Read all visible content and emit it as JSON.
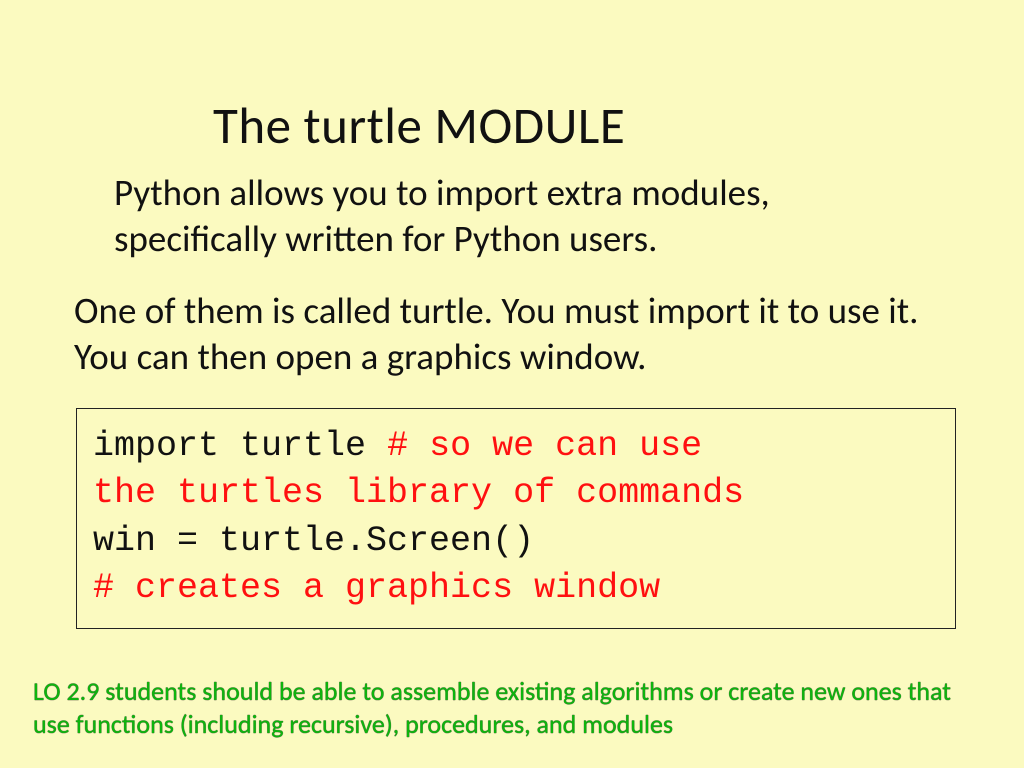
{
  "slide": {
    "title": "The turtle MODULE",
    "para1": "Python allows you to import extra modules, specifically written for Python users.",
    "para2": "One of them is called turtle.  You must import it to use it. You can then open a graphics window.",
    "code": {
      "l1a": "import turtle ",
      "l1b": "# so we can use",
      "l2": "the turtles library of commands",
      "l3": "win = turtle.Screen()",
      "l4": "# creates a graphics window"
    },
    "footer": "LO 2.9 students should be able to assemble existing algorithms or create new ones that use functions (including recursive), procedures, and modules"
  }
}
